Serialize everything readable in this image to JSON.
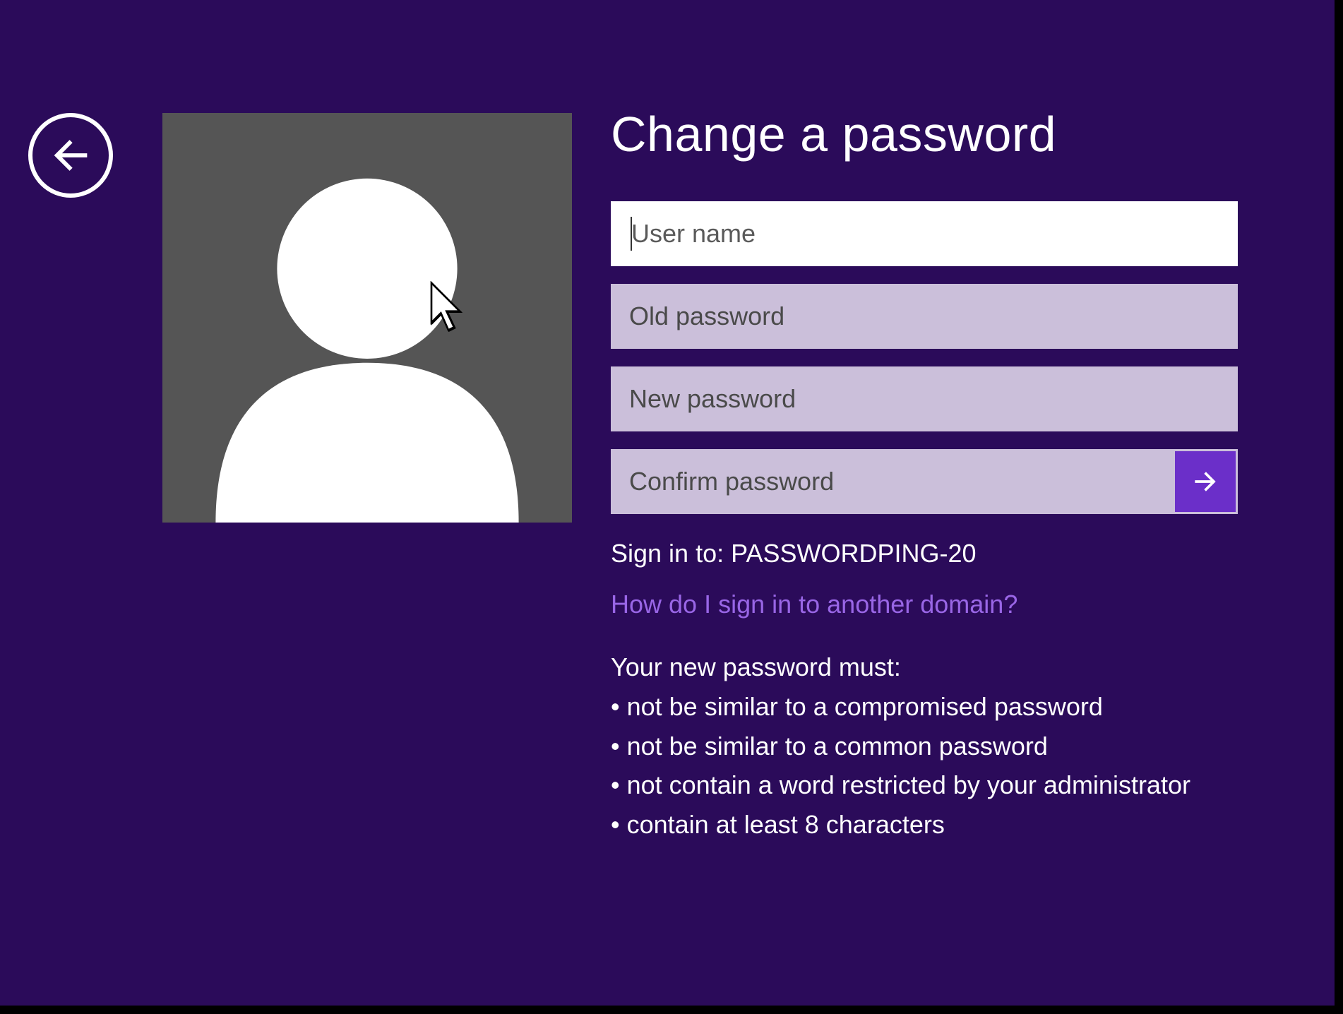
{
  "page": {
    "title": "Change a password"
  },
  "fields": {
    "username": {
      "placeholder": "User name",
      "value": ""
    },
    "old_password": {
      "placeholder": "Old password",
      "value": ""
    },
    "new_password": {
      "placeholder": "New password",
      "value": ""
    },
    "confirm_password": {
      "placeholder": "Confirm password",
      "value": ""
    }
  },
  "sign_in": {
    "prefix": "Sign in to: ",
    "domain": "PASSWORDPING-20"
  },
  "help_link": "How do I sign in to another domain?",
  "requirements": {
    "intro": "Your new password must:",
    "items": [
      "• not be similar to a compromised password",
      "• not be similar to a common password",
      "• not contain a word restricted by your administrator",
      "• contain at least 8 characters"
    ]
  },
  "icons": {
    "back": "arrow-left-icon",
    "submit": "arrow-right-icon",
    "avatar": "user-icon",
    "cursor": "cursor-icon"
  },
  "colors": {
    "background": "#2b0b5a",
    "accent": "#6b2fc9",
    "link": "#9966e6",
    "input_dimmed": "#cbbfda",
    "avatar_bg": "#555555"
  }
}
